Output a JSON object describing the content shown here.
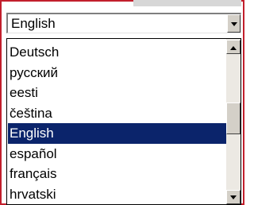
{
  "language_select": {
    "selected_value": "English",
    "options": [
      "Deutsch",
      "русский",
      "eesti",
      "čeština",
      "English",
      "español",
      "français",
      "hrvatski"
    ],
    "highlighted_option": "English",
    "icons": {
      "dropdown_toggle": "chevron-down-icon",
      "scroll_up": "scroll-up-icon",
      "scroll_down": "scroll-down-icon"
    }
  },
  "colors": {
    "frame_border": "#c21f2c",
    "selection_background": "#0b246b",
    "selection_text": "#ffffff"
  }
}
